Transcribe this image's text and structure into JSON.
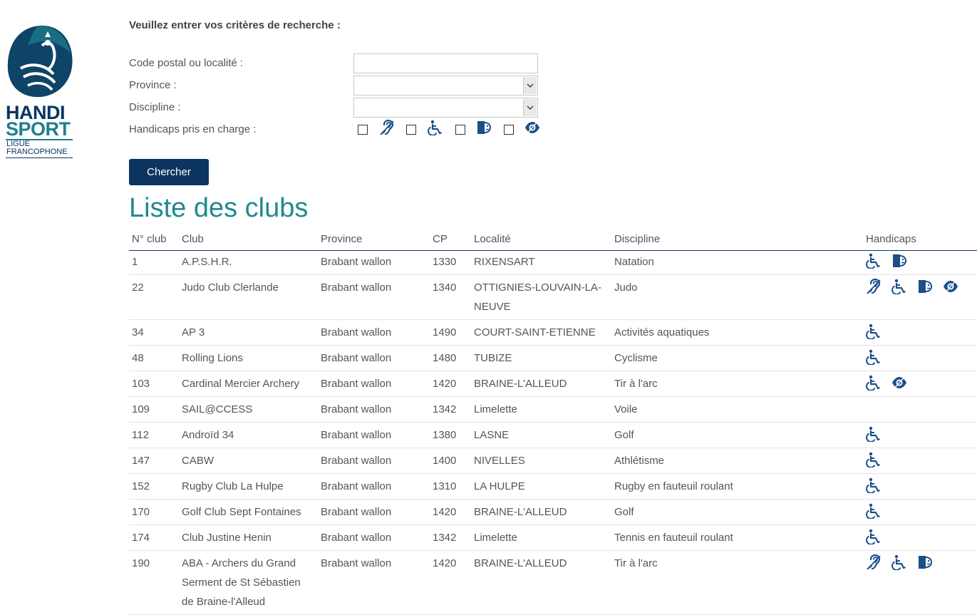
{
  "logo": {
    "word1": "HANDI",
    "word2": "SPORT",
    "sub1": "LIGUE",
    "sub2": "FRANCOPHONE"
  },
  "form": {
    "heading": "Veuillez entrer vos critères de recherche :",
    "postal_label": "Code postal ou localité :",
    "postal_value": "",
    "province_label": "Province :",
    "province_value": "",
    "discipline_label": "Discipline :",
    "discipline_value": "",
    "handicaps_label": "Handicaps pris en charge :",
    "search_button": "Chercher"
  },
  "colors": {
    "navy": "#0b3560",
    "teal": "#1e8a8f",
    "icon_blue": "#1a4f8a"
  },
  "list": {
    "title": "Liste des clubs",
    "headers": [
      "N° club",
      "Club",
      "Province",
      "CP",
      "Localité",
      "Discipline",
      "Handicaps"
    ],
    "rows": [
      {
        "num": "1",
        "club": "A.P.S.H.R.",
        "province": "Brabant wallon",
        "cp": "1330",
        "localite": "RIXENSART",
        "discipline": "Natation",
        "icons": [
          "wheelchair-icon",
          "mental-icon"
        ]
      },
      {
        "num": "22",
        "club": "Judo Club Clerlande",
        "province": "Brabant wallon",
        "cp": "1340",
        "localite": "OTTIGNIES-LOUVAIN-LA-NEUVE",
        "discipline": "Judo",
        "icons": [
          "hearing-icon",
          "wheelchair-icon",
          "mental-icon",
          "visual-icon"
        ]
      },
      {
        "num": "34",
        "club": "AP 3",
        "province": "Brabant wallon",
        "cp": "1490",
        "localite": "COURT-SAINT-ETIENNE",
        "discipline": "Activités aquatiques",
        "icons": [
          "wheelchair-icon"
        ]
      },
      {
        "num": "48",
        "club": "Rolling Lions",
        "province": "Brabant wallon",
        "cp": "1480",
        "localite": "TUBIZE",
        "discipline": "Cyclisme",
        "icons": [
          "wheelchair-icon"
        ]
      },
      {
        "num": "103",
        "club": "Cardinal Mercier Archery",
        "province": "Brabant wallon",
        "cp": "1420",
        "localite": "BRAINE-L'ALLEUD",
        "discipline": "Tir à l'arc",
        "icons": [
          "wheelchair-icon",
          "visual-icon"
        ]
      },
      {
        "num": "109",
        "club": "SAIL@CCESS",
        "province": "Brabant wallon",
        "cp": "1342",
        "localite": "Limelette",
        "discipline": "Voile",
        "icons": []
      },
      {
        "num": "112",
        "club": "Androïd 34",
        "province": "Brabant wallon",
        "cp": "1380",
        "localite": "LASNE",
        "discipline": "Golf",
        "icons": [
          "wheelchair-icon"
        ]
      },
      {
        "num": "147",
        "club": "CABW",
        "province": "Brabant wallon",
        "cp": "1400",
        "localite": "NIVELLES",
        "discipline": "Athlétisme",
        "icons": [
          "wheelchair-icon"
        ]
      },
      {
        "num": "152",
        "club": "Rugby Club La Hulpe",
        "province": "Brabant wallon",
        "cp": "1310",
        "localite": "LA HULPE",
        "discipline": "Rugby en fauteuil roulant",
        "icons": [
          "wheelchair-icon"
        ]
      },
      {
        "num": "170",
        "club": "Golf Club Sept Fontaines",
        "province": "Brabant wallon",
        "cp": "1420",
        "localite": "BRAINE-L'ALLEUD",
        "discipline": "Golf",
        "icons": [
          "wheelchair-icon"
        ]
      },
      {
        "num": "174",
        "club": "Club Justine Henin",
        "province": "Brabant wallon",
        "cp": "1342",
        "localite": "Limelette",
        "discipline": "Tennis en fauteuil roulant",
        "icons": [
          "wheelchair-icon"
        ]
      },
      {
        "num": "190",
        "club": "ABA - Archers du Grand Serment de St Sébastien de Braine-l'Alleud",
        "province": "Brabant wallon",
        "cp": "1420",
        "localite": "BRAINE-L'ALLEUD",
        "discipline": "Tir à l'arc",
        "icons": [
          "hearing-icon",
          "wheelchair-icon",
          "mental-icon"
        ]
      }
    ]
  }
}
